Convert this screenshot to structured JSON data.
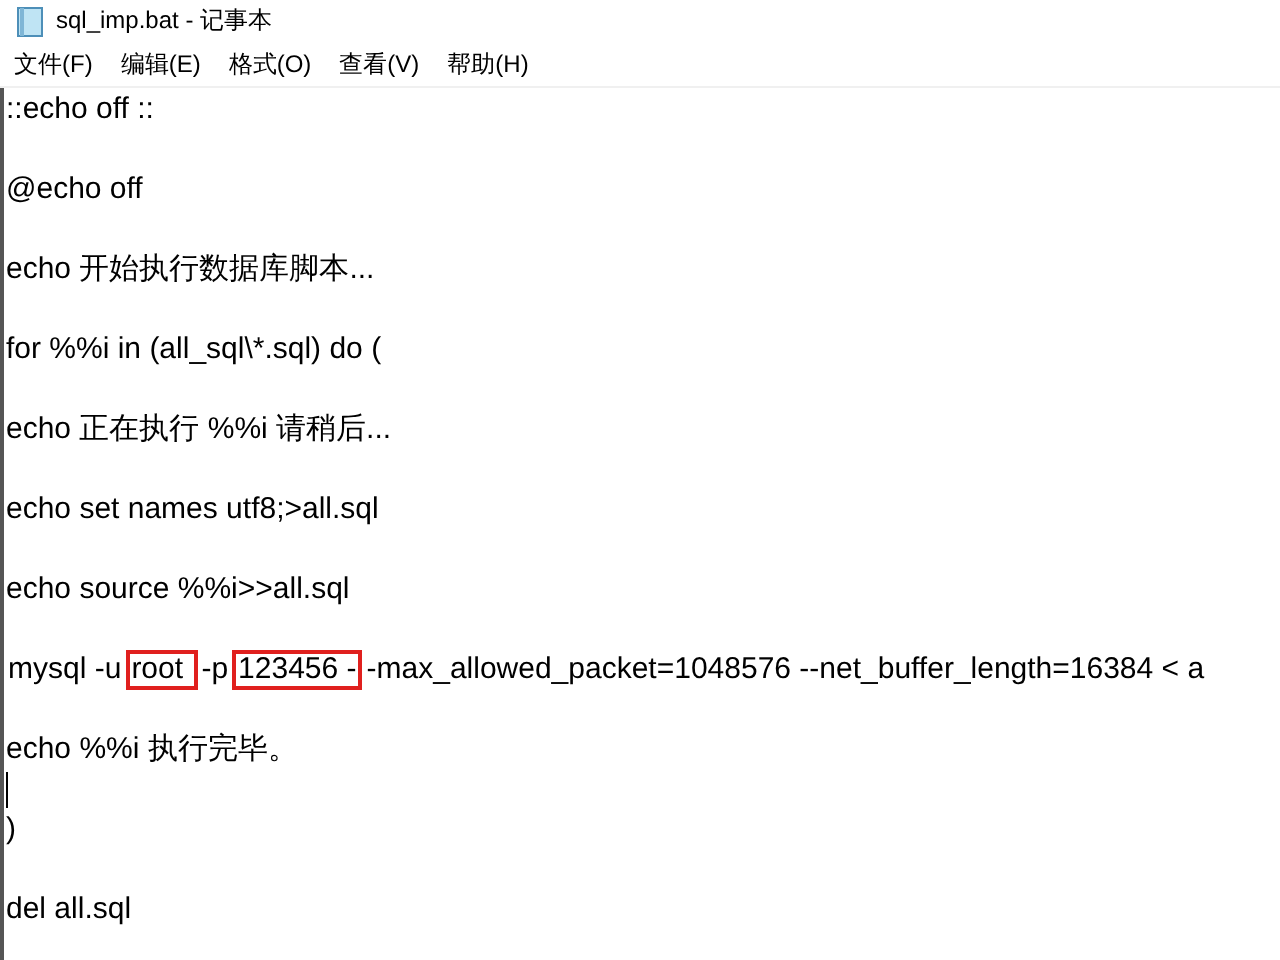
{
  "window": {
    "title": "sql_imp.bat - 记事本"
  },
  "menu": [
    "文件(F)",
    "编辑(E)",
    "格式(O)",
    "查看(V)",
    "帮助(H)"
  ],
  "lines": [
    {
      "kind": "text",
      "text": "::echo off ::"
    },
    {
      "kind": "text",
      "text": "@echo off"
    },
    {
      "kind": "text",
      "text": "echo 开始执行数据库脚本..."
    },
    {
      "kind": "text",
      "text": "for %%i in (all_sql\\*.sql) do ("
    },
    {
      "kind": "text",
      "text": "echo 正在执行 %%i 请稍后..."
    },
    {
      "kind": "text",
      "text": "echo set names utf8;>all.sql"
    },
    {
      "kind": "text",
      "text": "echo source %%i>>all.sql"
    },
    {
      "kind": "marked",
      "segments": [
        {
          "text": "mysql -u",
          "boxed": false
        },
        {
          "text": "root ",
          "boxed": true
        },
        {
          "text": "-p",
          "boxed": false
        },
        {
          "text": "123456 -",
          "boxed": true
        },
        {
          "text": "-max_allowed_packet=1048576 --net_buffer_length=16384 < a",
          "boxed": false
        }
      ]
    },
    {
      "kind": "text",
      "text": "echo %%i 执行完毕。"
    },
    {
      "kind": "caret"
    },
    {
      "kind": "text",
      "text": ")"
    },
    {
      "kind": "text",
      "text": "del all.sql"
    }
  ]
}
